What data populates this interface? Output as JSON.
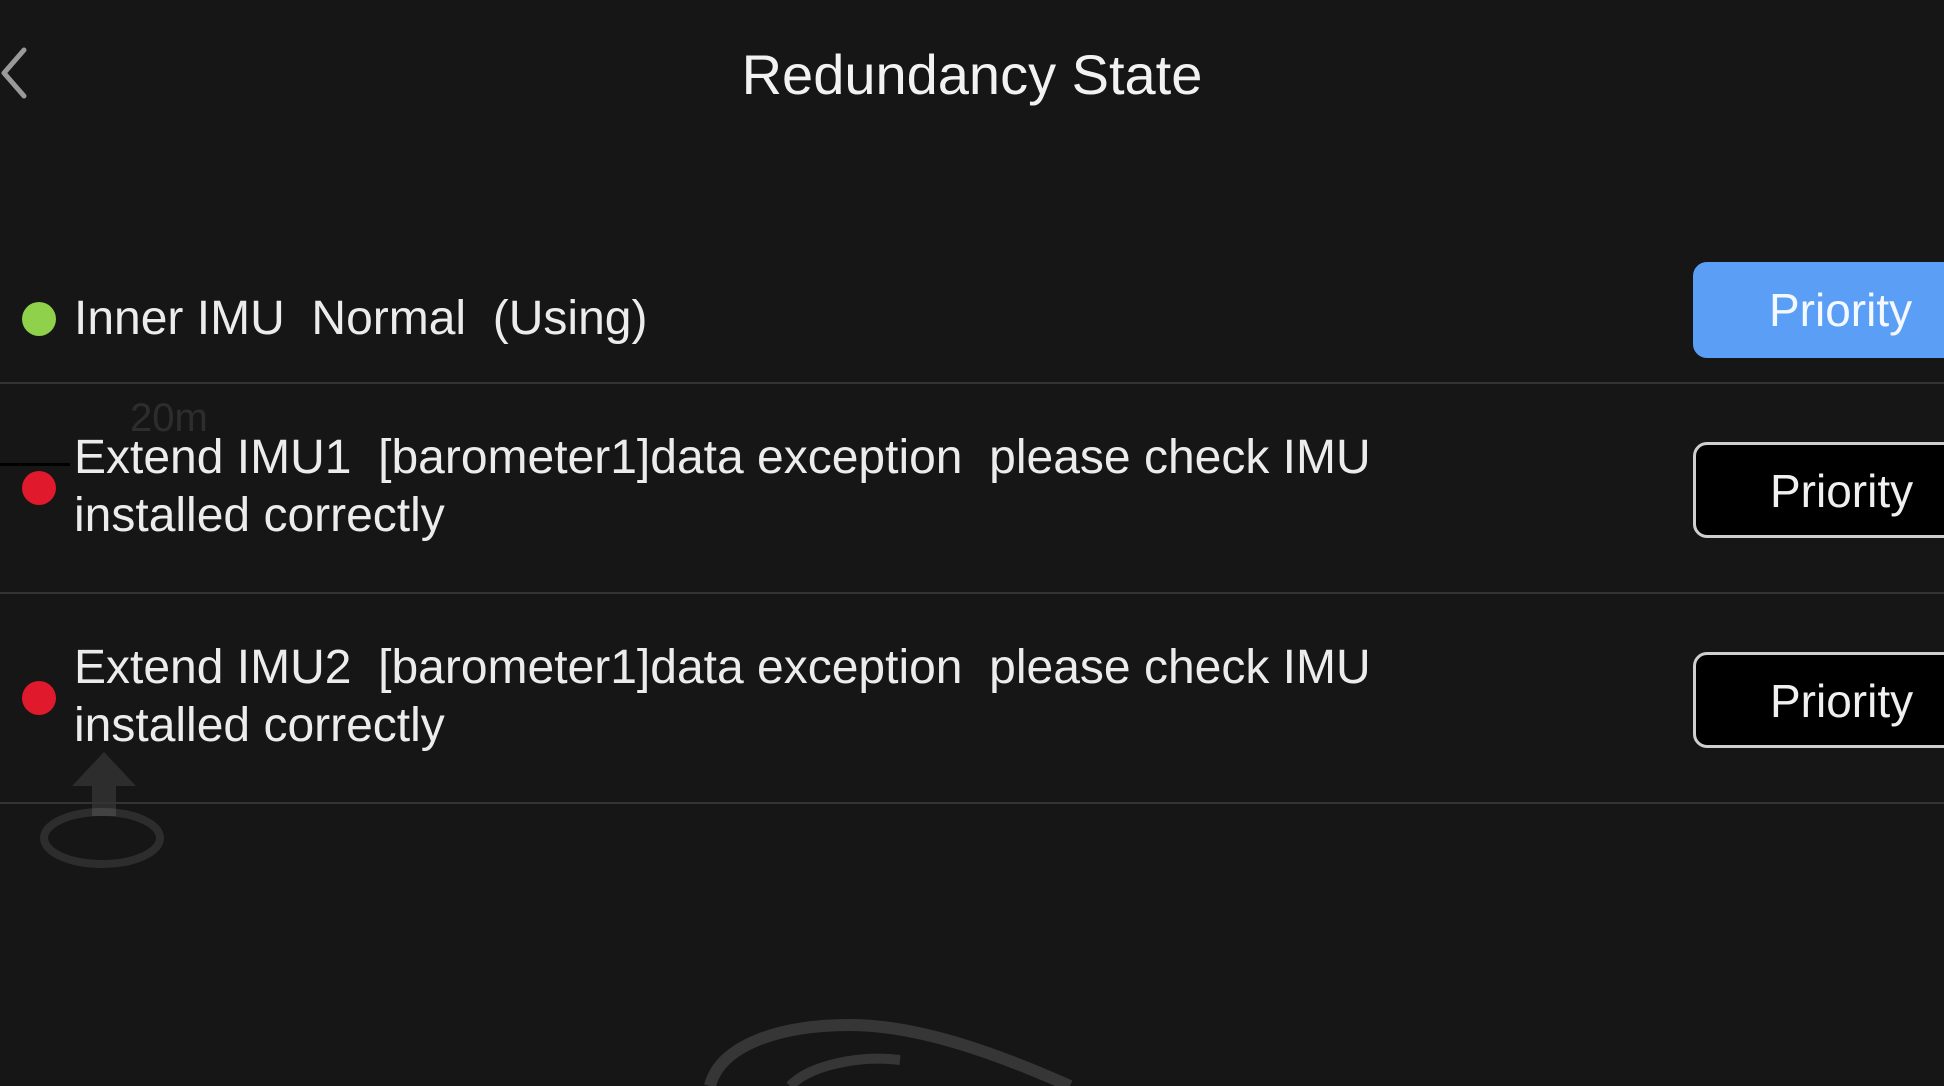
{
  "header": {
    "title": "Redundancy State"
  },
  "background": {
    "map_scale_label": "20m"
  },
  "imu_list": [
    {
      "text": "Inner IMU  Normal  (Using)",
      "status": "normal",
      "status_color": "#8fd14a",
      "priority_label": "Priority",
      "priority_active": true
    },
    {
      "text": "Extend IMU1  [barometer1]data exception  please check IMU installed correctly",
      "status": "error",
      "status_color": "#e0192c",
      "priority_label": "Priority",
      "priority_active": false
    },
    {
      "text": "Extend IMU2  [barometer1]data exception  please check IMU installed correctly",
      "status": "error",
      "status_color": "#e0192c",
      "priority_label": "Priority",
      "priority_active": false
    }
  ],
  "colors": {
    "background": "#161616",
    "accent": "#5b9ef5",
    "divider": "#333333"
  },
  "icons": {
    "back": "chevron-left-icon",
    "home": "home-point-icon"
  }
}
